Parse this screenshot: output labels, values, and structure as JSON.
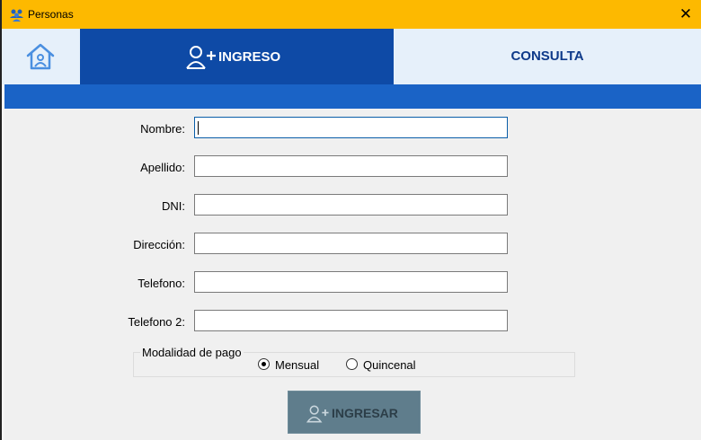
{
  "window": {
    "title": "Personas",
    "close_glyph": "✕",
    "app_icon": "people-icon"
  },
  "tabs": {
    "home_icon": "home-icon",
    "ingreso_label": "INGRESO",
    "ingreso_icon": "add-user-icon",
    "consulta_label": "CONSULTA"
  },
  "form": {
    "fields": [
      {
        "label": "Nombre:",
        "value": ""
      },
      {
        "label": "Apellido:",
        "value": ""
      },
      {
        "label": "DNI:",
        "value": ""
      },
      {
        "label": "Dirección:",
        "value": ""
      },
      {
        "label": "Telefono:",
        "value": ""
      },
      {
        "label": "Telefono 2:",
        "value": ""
      }
    ],
    "payment": {
      "legend": "Modalidad de pago",
      "options": [
        {
          "label": "Mensual",
          "selected": true
        },
        {
          "label": "Quincenal",
          "selected": false
        }
      ]
    },
    "submit_label": "INGRESAR",
    "submit_icon": "add-user-icon"
  },
  "colors": {
    "titlebar": "#fdb900",
    "tab_active": "#0e4aa6",
    "tab_inactive": "#e6f0fa",
    "strip": "#1a63c6",
    "button": "#5f7d8c"
  }
}
